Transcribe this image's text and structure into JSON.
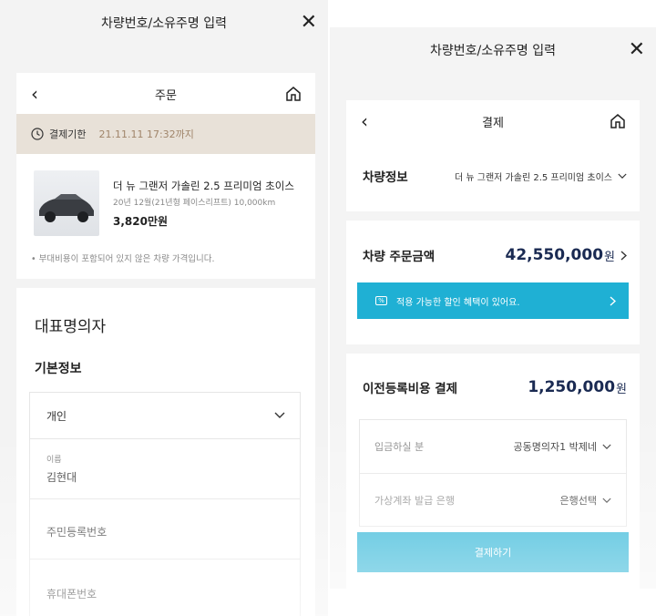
{
  "left": {
    "modal_title": "차량번호/소유주명 입력",
    "nav_title": "주문",
    "deadline_label": "결제기한",
    "deadline_date": "21.11.11 17:32까지",
    "car_name": "더 뉴 그랜저 가솔린 2.5 프리미엄 초이스",
    "car_spec": "20년 12월(21년형 페이스리프트)  10,000km",
    "car_price": "3,820만원",
    "notice": "• 부대비용이 포함되어 있지 않은 차량 가격입니다.",
    "section_title": "대표명의자",
    "subsection_title": "기본정보",
    "type_select": "개인",
    "name_label": "이름",
    "name_value": "김현대",
    "resident_label": "주민등록번호",
    "phone_label": "휴대폰번호"
  },
  "right": {
    "modal_title": "차량번호/소유주명 입력",
    "nav_title": "결제",
    "vehicle_label": "차량정보",
    "vehicle_value": "더 뉴 그랜저 가솔린 2.5 프리미엄 초이스",
    "order_label": "차량 주문금액",
    "order_amount": "42,550,000",
    "currency": "원",
    "discount_text": "적용 가능한 할인 혜택이 있어요.",
    "discount_badge": "%",
    "transfer_label": "이전등록비용 결제",
    "transfer_amount": "1,250,000",
    "depositor_label": "입금하실 분",
    "depositor_value": "공동명의자1 박제네",
    "bank_label": "가상계좌 발급 은행",
    "bank_value": "은행선택",
    "pay_button": "결제하기"
  },
  "colors": {
    "accent": "#1fb0d4",
    "deadline_bg": "#e8e1d8",
    "amount_navy": "#1a2a52"
  }
}
